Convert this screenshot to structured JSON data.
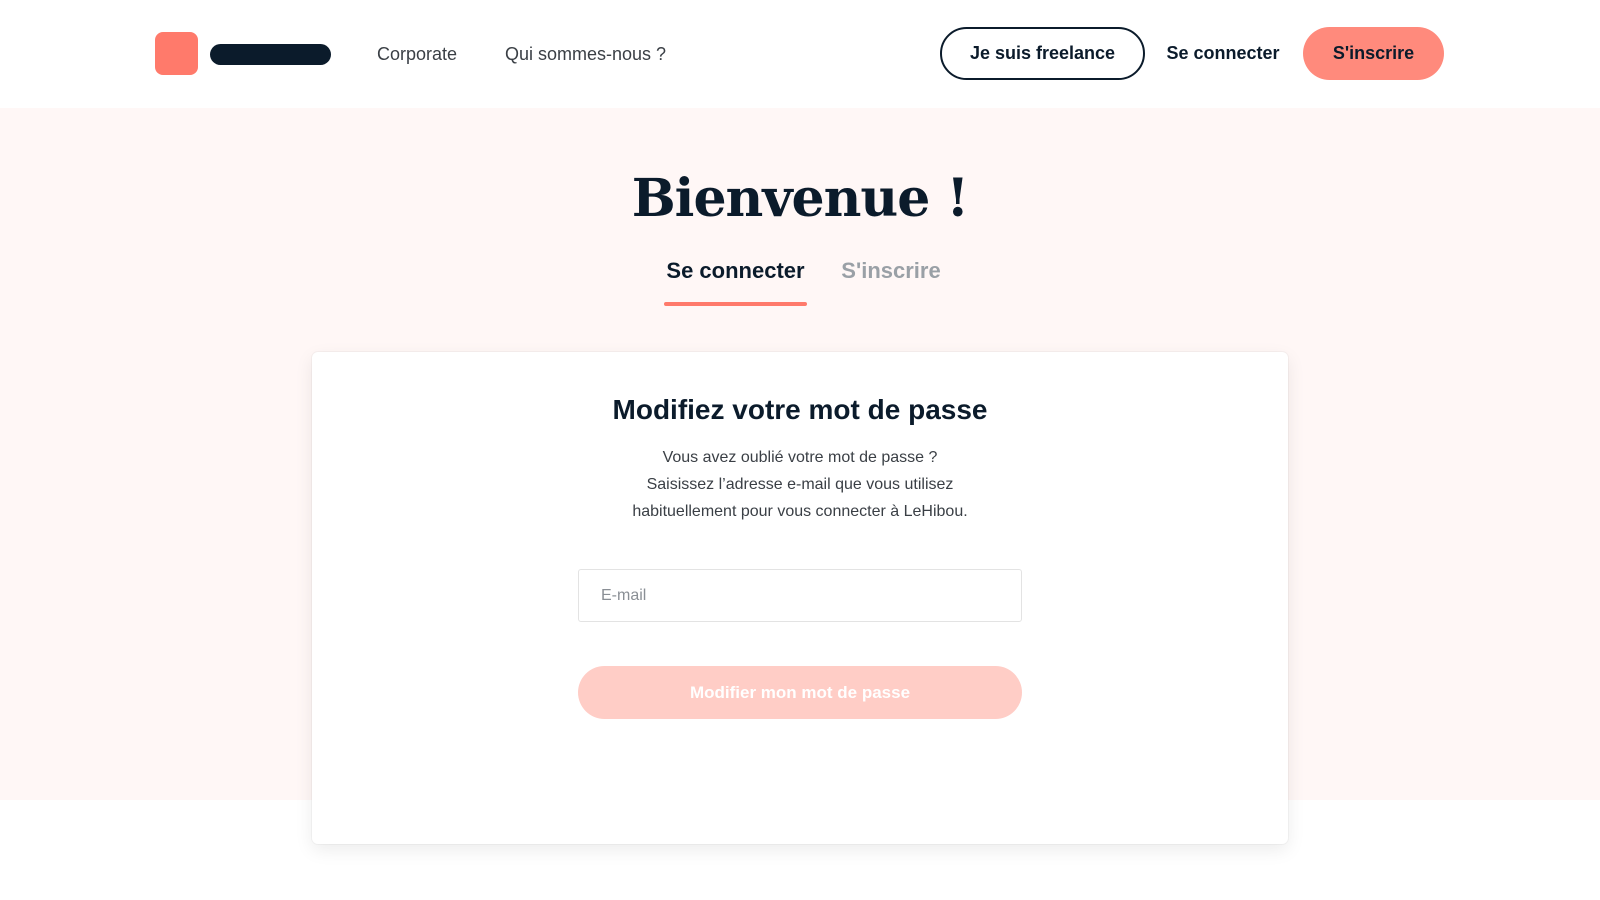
{
  "brand": {
    "logo_icon": "square-logo-mark",
    "accent_color": "#ff7a6b",
    "dark_color": "#0b1b2b"
  },
  "header": {
    "nav": [
      {
        "label": "Corporate"
      },
      {
        "label": "Qui sommes-nous ?"
      }
    ],
    "freelance_label": "Je suis freelance",
    "login_label": "Se connecter",
    "signup_label": "S'inscrire"
  },
  "hero": {
    "title": "Bienvenue !",
    "tabs": [
      {
        "label": "Se connecter",
        "active": true
      },
      {
        "label": "S'inscrire",
        "active": false
      }
    ]
  },
  "card": {
    "title": "Modifiez votre mot de passe",
    "description_lines": [
      "Vous avez oublié votre mot de passe ?",
      "Saisissez l’adresse e-mail que vous utilisez",
      "habituellement pour vous connecter à LeHibou."
    ],
    "email_placeholder": "E-mail",
    "email_value": "",
    "submit_label": "Modifier mon mot de passe"
  }
}
